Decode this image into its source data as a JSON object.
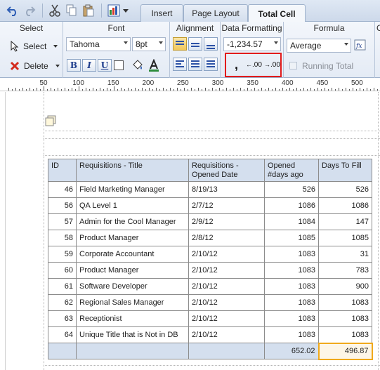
{
  "toolbar": {
    "icons": [
      "undo-icon",
      "redo-icon",
      "cut-icon",
      "copy-icon",
      "paste-icon",
      "insert-object-icon"
    ]
  },
  "tabs": [
    {
      "label": "Insert",
      "active": false
    },
    {
      "label": "Page Layout",
      "active": false
    },
    {
      "label": "Total Cell",
      "active": true
    }
  ],
  "ribbon": {
    "select_group": {
      "title": "Select",
      "select_label": "Select",
      "delete_label": "Delete"
    },
    "font_group": {
      "title": "Font",
      "font_name": "Tahoma",
      "font_size": "8pt",
      "bold": "B",
      "italic": "I",
      "underline": "U"
    },
    "alignment_group": {
      "title": "Alignment"
    },
    "data_formatting_group": {
      "title": "Data Formatting",
      "format_value": "-1,234.57",
      "comma_label": ",",
      "decrease_decimal_label": ".00",
      "increase_decimal_label": ".00"
    },
    "formula_group": {
      "title": "Formula",
      "formula_value": "Average",
      "running_total_label": "Running Total"
    },
    "next_group_title": "C"
  },
  "ruler": {
    "labels": [
      "50",
      "100",
      "150",
      "200",
      "250",
      "300",
      "350",
      "400",
      "450",
      "500"
    ]
  },
  "table": {
    "headers": [
      "ID",
      "Requisitions - Title",
      "Requisitions - Opened Date",
      "Opened #days ago",
      "Days To Fill"
    ],
    "rows": [
      [
        "46",
        "Field Marketing Manager",
        "8/19/13",
        "526",
        "526"
      ],
      [
        "56",
        "QA Level 1",
        "2/7/12",
        "1086",
        "1086"
      ],
      [
        "57",
        "Admin for the Cool Manager",
        "2/9/12",
        "1084",
        "147"
      ],
      [
        "58",
        "Product Manager",
        "2/8/12",
        "1085",
        "1085"
      ],
      [
        "59",
        "Corporate Accountant",
        "2/10/12",
        "1083",
        "31"
      ],
      [
        "60",
        "Product Manager",
        "2/10/12",
        "1083",
        "783"
      ],
      [
        "61",
        "Software Developer",
        "2/10/12",
        "1083",
        "900"
      ],
      [
        "62",
        "Regional Sales Manager",
        "2/10/12",
        "1083",
        "1083"
      ],
      [
        "63",
        "Receptionist",
        "2/10/12",
        "1083",
        "1083"
      ],
      [
        "64",
        "Unique Title that is Not in DB",
        "2/10/12",
        "1083",
        "1083"
      ]
    ],
    "totals": [
      "",
      "",
      "",
      "652.02",
      "496.87"
    ]
  },
  "colors": {
    "header_bg": "#d4dfee",
    "highlight_border": "#f0a91b",
    "annotation_red": "#e21b1b"
  }
}
